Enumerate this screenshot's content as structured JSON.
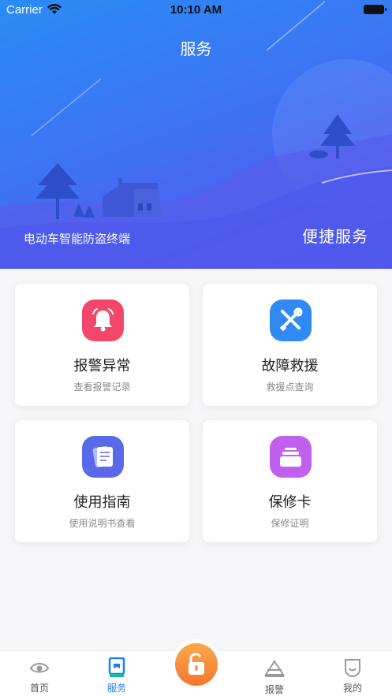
{
  "status_bar": {
    "carrier": "Carrier",
    "time": "10:10 AM"
  },
  "header": {
    "title": "服务",
    "tagline_left": "电动车智能防盗终端",
    "tagline_right": "便捷服务"
  },
  "services": [
    {
      "title": "报警异常",
      "subtitle": "查看报警记录",
      "icon": "bell-icon",
      "color": "#f2476a"
    },
    {
      "title": "故障救援",
      "subtitle": "救援点查询",
      "icon": "tools-icon",
      "color": "#2f8bf3"
    },
    {
      "title": "使用指南",
      "subtitle": "使用说明书查看",
      "icon": "document-icon",
      "color": "#5a68ea"
    },
    {
      "title": "保修卡",
      "subtitle": "保修证明",
      "icon": "card-box-icon",
      "color": "#c060ee"
    }
  ],
  "tabbar": {
    "home": "首页",
    "service": "服务",
    "alarm": "报警",
    "mine": "我的",
    "active_color": "#1f7df4",
    "center_icon": "unlock-icon"
  }
}
